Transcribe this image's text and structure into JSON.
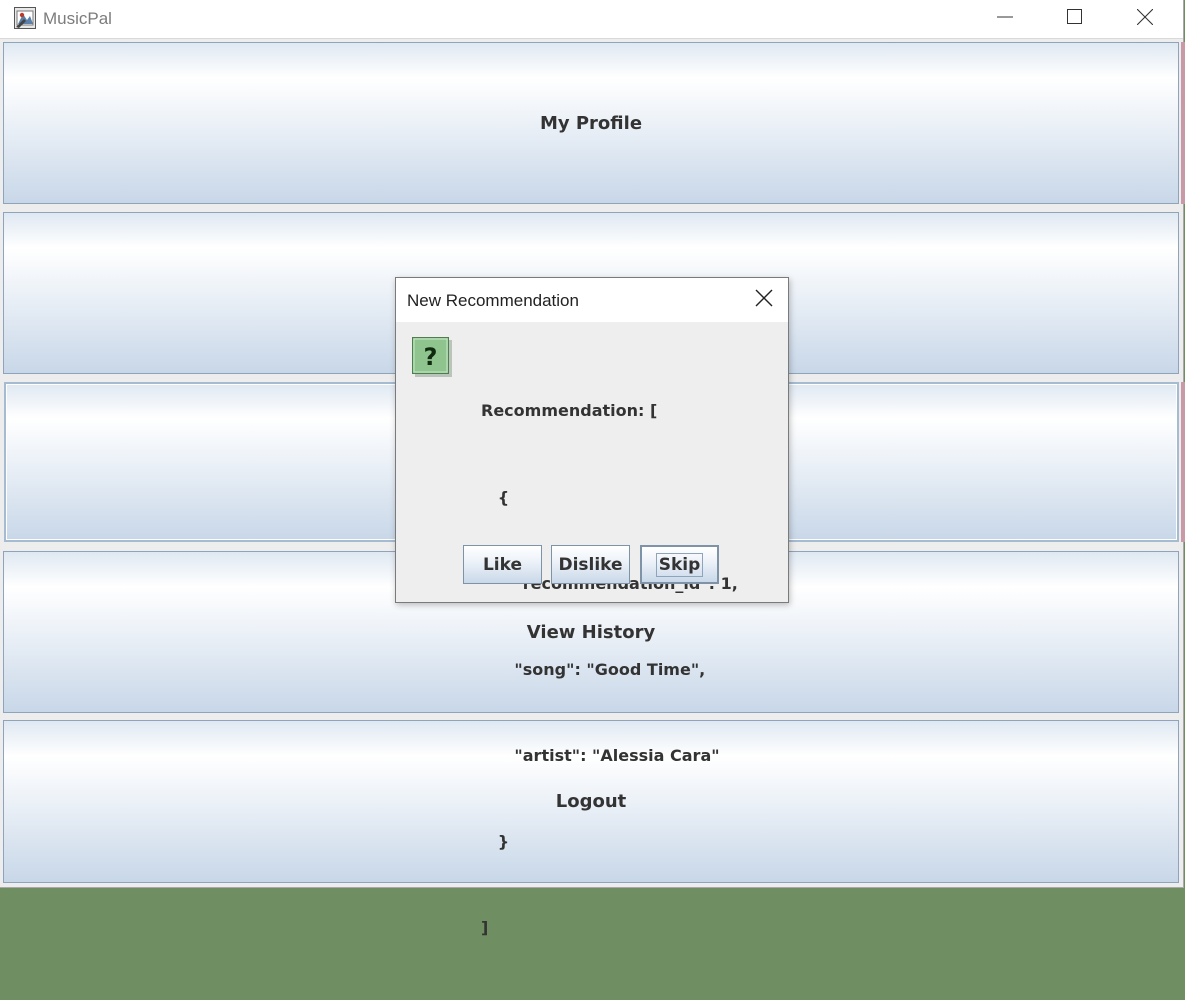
{
  "window": {
    "title": "MusicPal",
    "icons": {
      "app": "musicpal-app-icon",
      "minimize": "minimize-icon",
      "maximize": "maximize-icon",
      "close": "close-icon"
    }
  },
  "main_menu": {
    "my_profile_label": "My Profile",
    "hidden_button_1_label": "",
    "hidden_button_2_label": "",
    "view_history_label": "View History",
    "logout_label": "Logout"
  },
  "dialog": {
    "title": "New Recommendation",
    "icon": "question-icon",
    "message_lines": [
      "Recommendation: [",
      "   {",
      "      \"recommendation_id\": 1,",
      "      \"song\": \"Good Time\",",
      "      \"artist\": \"Alessia Cara\"",
      "   }",
      "]"
    ],
    "buttons": {
      "like_label": "Like",
      "dislike_label": "Dislike",
      "skip_label": "Skip"
    }
  },
  "colors": {
    "button_border": "#8ea4ba",
    "button_gradient_top": "#ffffff",
    "button_gradient_bottom": "#c8d7e8",
    "text": "#333333"
  }
}
